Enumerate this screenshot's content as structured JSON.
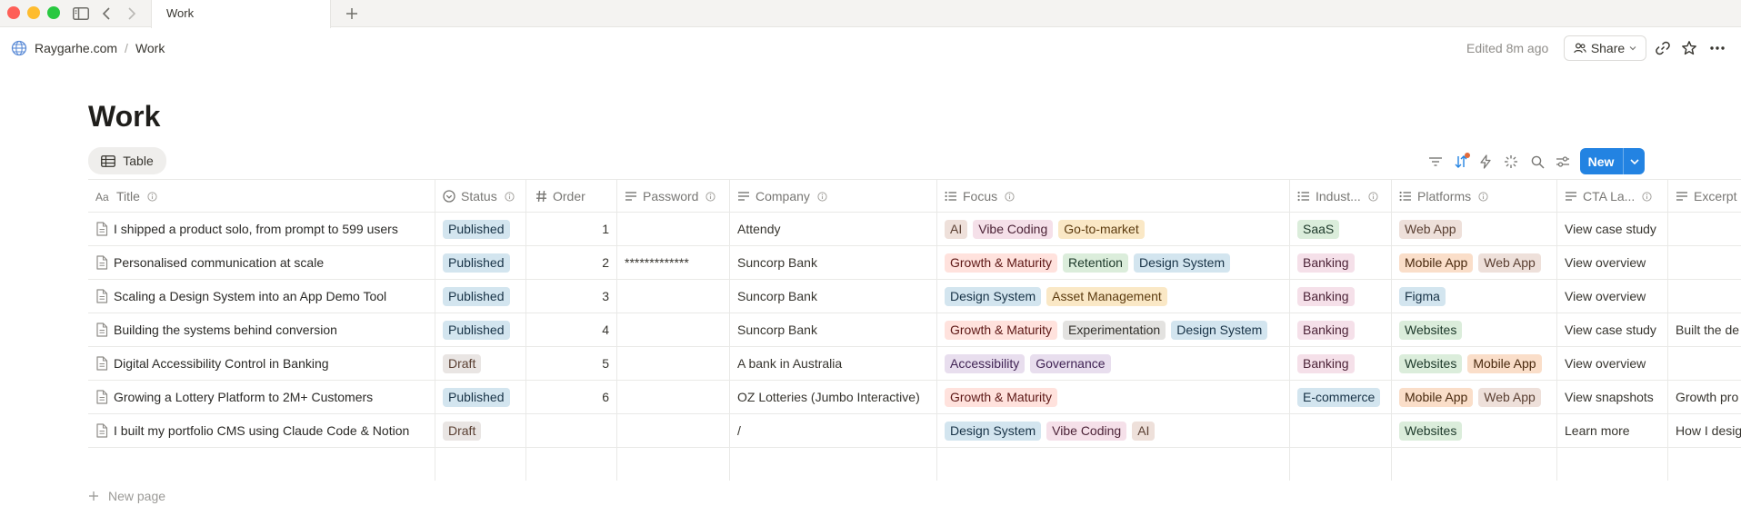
{
  "window": {
    "tab_title": "Work"
  },
  "breadcrumb": {
    "workspace": "Raygarhe.com",
    "separator": "/",
    "page": "Work"
  },
  "topbar": {
    "edited": "Edited 8m ago",
    "share_label": "Share"
  },
  "page": {
    "title": "Work",
    "view_label": "Table",
    "new_label": "New",
    "new_page_label": "New page"
  },
  "table": {
    "columns": [
      {
        "key": "title",
        "label": "Title",
        "icon": "aa-text-icon"
      },
      {
        "key": "status",
        "label": "Status",
        "icon": "status-icon"
      },
      {
        "key": "order",
        "label": "Order",
        "icon": "hash-icon"
      },
      {
        "key": "password",
        "label": "Password",
        "icon": "text-lines-icon"
      },
      {
        "key": "company",
        "label": "Company",
        "icon": "text-lines-icon"
      },
      {
        "key": "focus",
        "label": "Focus",
        "icon": "list-icon"
      },
      {
        "key": "industry",
        "label": "Indust...",
        "icon": "list-icon"
      },
      {
        "key": "platforms",
        "label": "Platforms",
        "icon": "list-icon"
      },
      {
        "key": "cta",
        "label": "CTA La...",
        "icon": "text-lines-icon"
      },
      {
        "key": "excerpt",
        "label": "Excerpt",
        "icon": "text-lines-icon"
      }
    ],
    "rows": [
      {
        "title": "I shipped a product solo, from prompt to 599 users",
        "status": "Published",
        "order": "1",
        "password": "",
        "company": "Attendy",
        "focus": [
          "AI",
          "Vibe Coding",
          "Go-to-market"
        ],
        "industry": [
          "SaaS"
        ],
        "platforms": [
          "Web App"
        ],
        "cta": "View case study",
        "excerpt": ""
      },
      {
        "title": "Personalised communication at scale",
        "status": "Published",
        "order": "2",
        "password": "*************",
        "company": "Suncorp Bank",
        "focus": [
          "Growth & Maturity",
          "Retention",
          "Design System"
        ],
        "industry": [
          "Banking"
        ],
        "platforms": [
          "Mobile App",
          "Web App"
        ],
        "cta": "View overview",
        "excerpt": ""
      },
      {
        "title": "Scaling a Design System into an App Demo Tool",
        "status": "Published",
        "order": "3",
        "password": "",
        "company": "Suncorp Bank",
        "focus": [
          "Design System",
          "Asset Management"
        ],
        "industry": [
          "Banking"
        ],
        "platforms": [
          "Figma"
        ],
        "cta": "View overview",
        "excerpt": ""
      },
      {
        "title": "Building the systems behind conversion",
        "status": "Published",
        "order": "4",
        "password": "",
        "company": "Suncorp Bank",
        "focus": [
          "Growth & Maturity",
          "Experimentation",
          "Design System"
        ],
        "industry": [
          "Banking"
        ],
        "platforms": [
          "Websites"
        ],
        "cta": "View case study",
        "excerpt": "Built the de"
      },
      {
        "title": "Digital Accessibility Control in Banking",
        "status": "Draft",
        "order": "5",
        "password": "",
        "company": "A bank in Australia",
        "focus": [
          "Accessibility",
          "Governance"
        ],
        "industry": [
          "Banking"
        ],
        "platforms": [
          "Websites",
          "Mobile App"
        ],
        "cta": "View overview",
        "excerpt": ""
      },
      {
        "title": "Growing a Lottery Platform to 2M+ Customers",
        "status": "Published",
        "order": "6",
        "password": "",
        "company": "OZ Lotteries (Jumbo Interactive)",
        "focus": [
          "Growth & Maturity"
        ],
        "industry": [
          "E-commerce"
        ],
        "platforms": [
          "Mobile App",
          "Web App"
        ],
        "cta": "View snapshots",
        "excerpt": "Growth pro"
      },
      {
        "title": "I built my portfolio CMS using Claude Code & Notion",
        "status": "Draft",
        "order": "",
        "password": "",
        "company": "/",
        "focus": [
          "Design System",
          "Vibe Coding",
          "AI"
        ],
        "industry": [],
        "platforms": [
          "Websites"
        ],
        "cta": "Learn more",
        "excerpt": "How I desig"
      }
    ]
  },
  "tag_colors": {
    "Published": {
      "bg": "#d3e5ef",
      "fg": "#183347"
    },
    "Draft": {
      "bg": "#e9e5e3",
      "fg": "#5a3f32"
    },
    "AI": {
      "bg": "#eee0da",
      "fg": "#5a3f32"
    },
    "Vibe Coding": {
      "bg": "#f5e0e9",
      "fg": "#4c2337"
    },
    "Go-to-market": {
      "bg": "#fae8c6",
      "fg": "#5c3b0f"
    },
    "Growth & Maturity": {
      "bg": "#ffe2dd",
      "fg": "#5d1715"
    },
    "Retention": {
      "bg": "#dbeddb",
      "fg": "#1c3829"
    },
    "Design System": {
      "bg": "#d3e5ef",
      "fg": "#183347"
    },
    "Asset Management": {
      "bg": "#fae8c6",
      "fg": "#5c3b0f"
    },
    "Experimentation": {
      "bg": "#e3e2e0",
      "fg": "#32302c"
    },
    "Accessibility": {
      "bg": "#e8deee",
      "fg": "#412454"
    },
    "Governance": {
      "bg": "#e8deee",
      "fg": "#412454"
    },
    "SaaS": {
      "bg": "#dbeddb",
      "fg": "#1c3829"
    },
    "Banking": {
      "bg": "#f5e0e9",
      "fg": "#4c2337"
    },
    "E-commerce": {
      "bg": "#d3e5ef",
      "fg": "#183347"
    },
    "Web App": {
      "bg": "#eee0da",
      "fg": "#5a3f32"
    },
    "Mobile App": {
      "bg": "#fadec9",
      "fg": "#49290e"
    },
    "Figma": {
      "bg": "#d3e5ef",
      "fg": "#183347"
    },
    "Websites": {
      "bg": "#dbeddb",
      "fg": "#1c3829"
    }
  },
  "colors": {
    "accent": "#2383e2",
    "sort_indicator": "#e26a3a"
  }
}
